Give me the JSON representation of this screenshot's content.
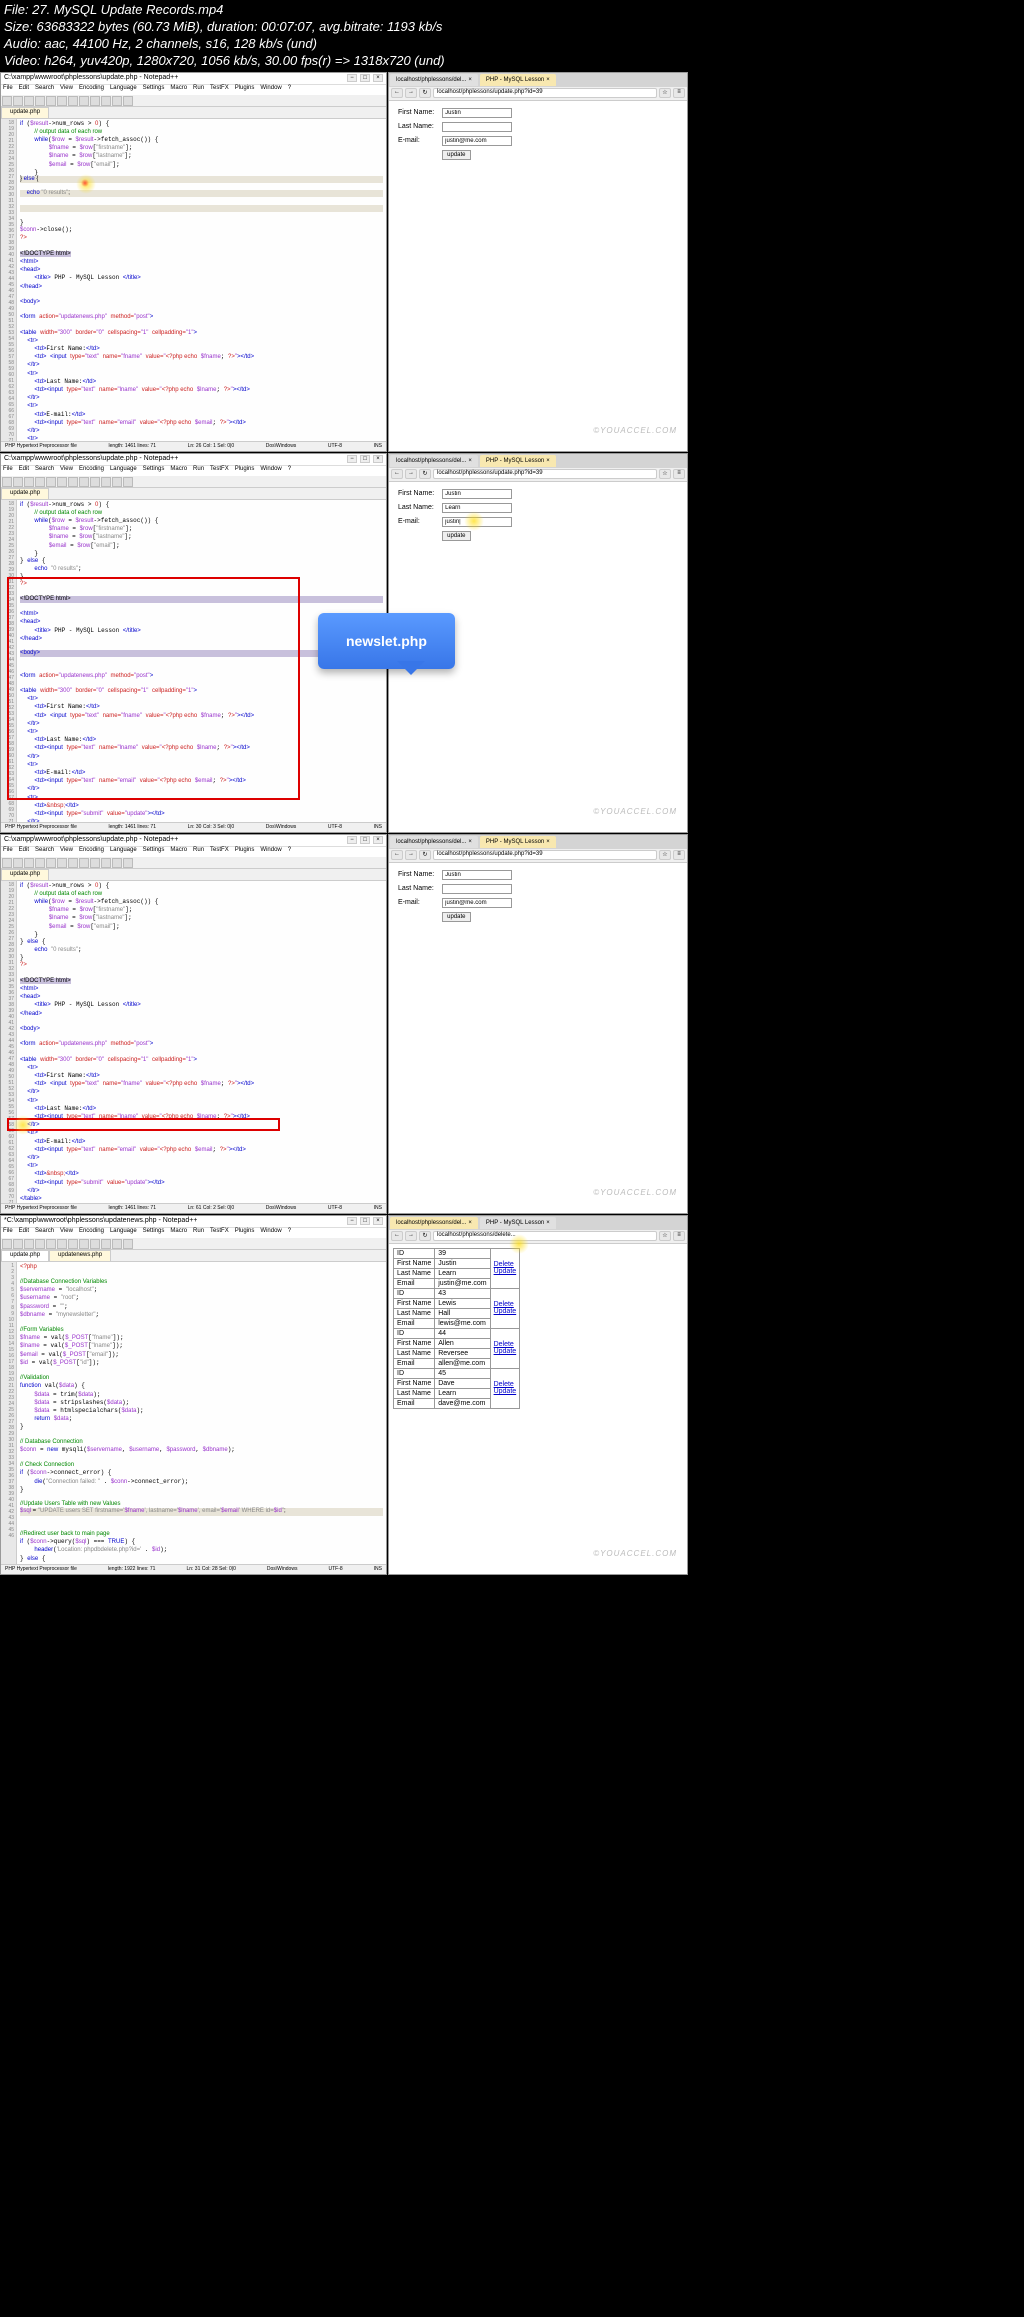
{
  "fileInfo": {
    "line1": "File: 27. MySQL Update Records.mp4",
    "line2": "Size: 63683322 bytes (60.73 MiB), duration: 00:07:07, avg.bitrate: 1193 kb/s",
    "line3": "Audio: aac, 44100 Hz, 2 channels, s16, 128 kb/s (und)",
    "line4": "Video: h264, yuv420p, 1280x720, 1056 kb/s, 30.00 fps(r) => 1318x720 (und)"
  },
  "notepad": {
    "title": "C:\\xampp\\wwwroot\\phplessons\\update.php - Notepad++",
    "menu": [
      "File",
      "Edit",
      "Search",
      "View",
      "Encoding",
      "Language",
      "Settings",
      "Macro",
      "Run",
      "TestFX",
      "Plugins",
      "Window",
      "?"
    ],
    "tab": "update.php",
    "status": {
      "lang": "PHP Hypertext Preprocessor file",
      "f1": {
        "len": "length: 1461  lines: 71",
        "pos": "Ln: 26  Col: 1  Sel: 0|0",
        "enc": "Dos\\Windows",
        "utf": "UTF-8",
        "ins": "INS"
      },
      "f2": {
        "len": "length: 1461  lines: 71",
        "pos": "Ln: 30  Col: 3  Sel: 0|0"
      },
      "f3": {
        "len": "length: 1461  lines: 71",
        "pos": "Ln: 61  Col: 2  Sel: 0|0"
      },
      "f4": {
        "len": "length: 1922  lines: 71",
        "pos": "Ln: 31  Col: 28  Sel: 0|0"
      }
    }
  },
  "browser": {
    "tabs": {
      "t1": "localhost/phplessons/del...",
      "t2": "PHP - MySQL Lesson"
    },
    "url": "localhost/phplessons/update.php?id=39",
    "url4": "localhost/phplessons/delete..."
  },
  "form": {
    "labels": {
      "fn": "First Name:",
      "ln": "Last Name:",
      "em": "E-mail:"
    },
    "vals1": {
      "fn": "Justin",
      "ln": "",
      "em": "justin@me.com"
    },
    "vals2": {
      "fn": "Justin",
      "ln": "Learn",
      "em": "justin|"
    },
    "vals3": {
      "fn": "Justin",
      "ln": "",
      "em": "justin@me.com"
    },
    "btn": "update"
  },
  "dataTable": {
    "rows": [
      {
        "id": "39",
        "fn": "Justin",
        "ln": "Learn",
        "em": "justin@me.com",
        "del": "Delete",
        "upd": "Update"
      },
      {
        "id": "43",
        "fn": "Lewis",
        "ln": "Hall",
        "em": "lewis@me.com",
        "del": "Delete",
        "upd": "Update"
      },
      {
        "id": "44",
        "fn": "Allen",
        "ln": "Reversee",
        "em": "allen@me.com",
        "del": "Delete",
        "upd": "Update"
      },
      {
        "id": "45",
        "fn": "Dave",
        "ln": "Learn",
        "em": "dave@me.com",
        "del": "Delete",
        "upd": "Update"
      }
    ],
    "hdrs": {
      "id": "ID",
      "fn": "First Name",
      "ln": "Last Name",
      "em": "Email"
    }
  },
  "callout": "newslet.php",
  "watermark": "©YOUACCEL.COM",
  "code": {
    "frame1to3": "if ($result->num_rows > 0) {\n    // output data of each row\n    while($row = $result->fetch_assoc()) {\n        $fname = $row[\"firstname\"];\n        $lname = $row[\"lastname\"];\n        $email = $row[\"email\"];\n    }\n} else {\n    echo \"0 results\";\n    *\n}\n$conn->close();\n?>\n\n<!DOCTYPE html>\n<html>\n<head>\n    <title> PHP - MySQL Lesson </title>\n</head>\n\n<body>\n\n<form action=\"updatenews.php\" method=\"post\">\n\n<table width=\"300\" border=\"0\" cellspacing=\"1\" cellpadding=\"1\">\n  <tr>\n    <td>First Name:</td>\n    <td> <input type=\"text\" name=\"fname\" value=\"<?php echo $fname; ?>\"></td>\n  </tr>\n  <tr>\n    <td>Last Name:</td>\n    <td><input type=\"text\" name=\"lname\" value=\"<?php echo $lname; ?>\"></td>\n  </tr>\n  <tr>\n    <td>E-mail:</td>\n    <td><input type=\"text\" name=\"email\" value=\"<?php echo $email; ?>\"></td>\n  </tr>\n  <tr>\n    <td>&nbsp;</td>\n    <td><input type=\"submit\" value=\"update\"></td>\n  </tr>\n</table>\n\n<input type=\"hidden\" name=\"id\" value=\"<?php echo $id ?>\">\n\n</form>\n\n</body>\n</html>\n\n<?php\n}\n$conn->close();\n?>",
    "frame4": "<?php\n\n//Database Connection Variables\n$servername = \"localhost\";\n$username = \"root\";\n$password = \"\";\n$dbname = \"mynewsletter\";\n\n//Form Variables\n$fname = val($_POST[\"fname\"]);\n$lname = val($_POST[\"lname\"]);\n$email = val($_POST[\"email\"]);\n$id = val($_POST[\"id\"]);\n\n//Validation\nfunction val($data) {\n    $data = trim($data);\n    $data = stripslashes($data);\n    $data = htmlspecialchars($data);\n    return $data;\n}\n\n// Database Connection\n$conn = new mysqli($servername, $username, $password, $dbname);\n\n// Check Connection\nif ($conn->connect_error) {\n    die(\"Connection failed: \" . $conn->connect_error);\n}\n\n//Update Users Table with new Values\n$sql = \"UPDATE users SET firstname='$fname', lastname='$lname', email='$email' WHERE id=$id\";\n\n//Redirect user back to main page\nif ($conn->query($sql) === TRUE) {\n    header('Location: phpdbdelete.php?id=' . $id);\n} else {\n    echo \"Error updating record: \" . $conn->error;\n}\n\n//Close Database Connection\n$conn->close();\n\n?>"
  }
}
